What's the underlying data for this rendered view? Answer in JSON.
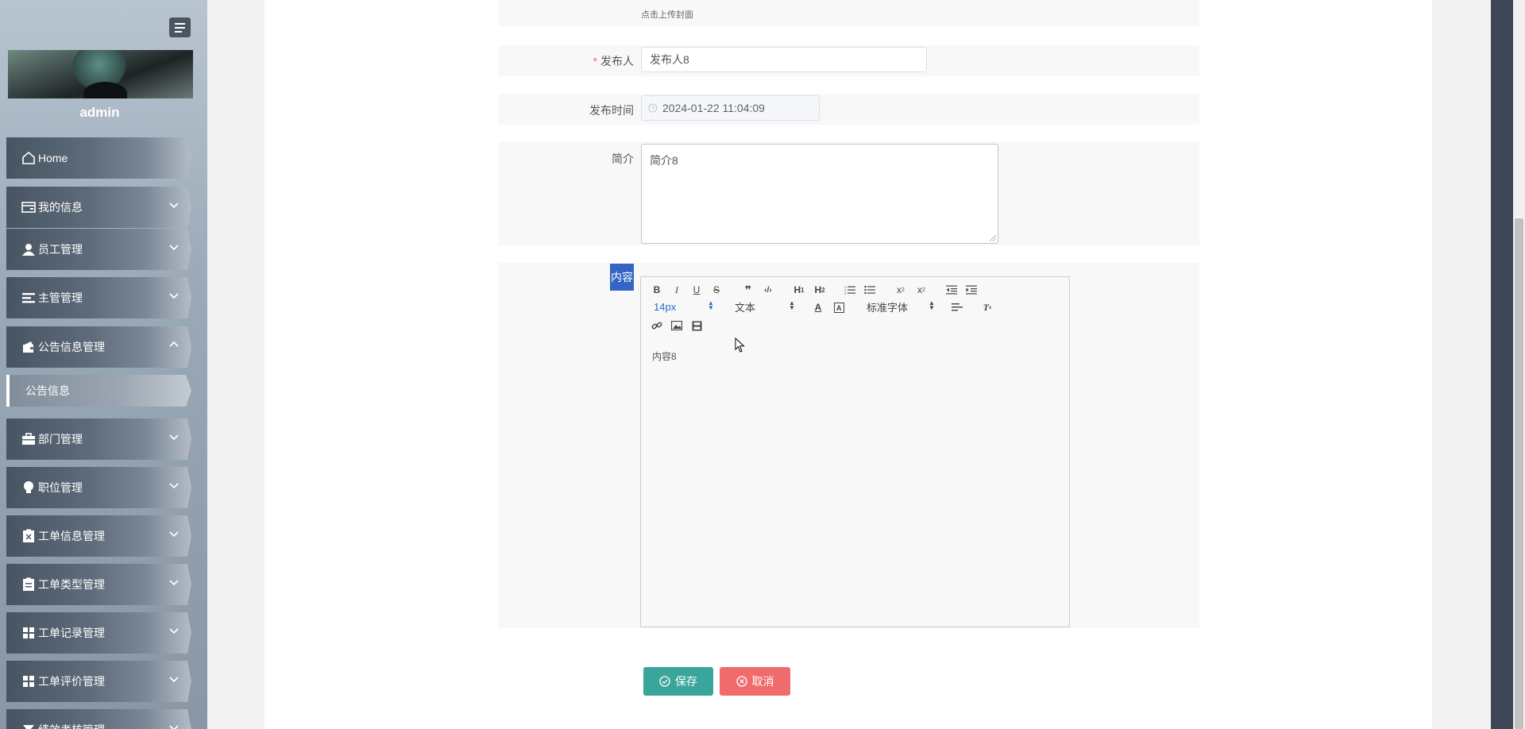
{
  "sidebar": {
    "username": "admin",
    "menu": [
      {
        "label": "Home",
        "icon": "home-icon",
        "has_chevron": false
      },
      {
        "label": "我的信息",
        "icon": "wallet-icon",
        "has_chevron": true
      },
      {
        "label": "员工管理",
        "icon": "user-icon",
        "has_chevron": true
      },
      {
        "label": "主管管理",
        "icon": "list-icon",
        "has_chevron": true
      },
      {
        "label": "公告信息管理",
        "icon": "wallet-icon",
        "has_chevron": true,
        "expanded": true
      },
      {
        "label": "部门管理",
        "icon": "briefcase-icon",
        "has_chevron": true
      },
      {
        "label": "职位管理",
        "icon": "lightbulb-icon",
        "has_chevron": true
      },
      {
        "label": "工单信息管理",
        "icon": "clipboard-x-icon",
        "has_chevron": true
      },
      {
        "label": "工单类型管理",
        "icon": "clipboard-icon",
        "has_chevron": true
      },
      {
        "label": "工单记录管理",
        "icon": "grid-icon",
        "has_chevron": true
      },
      {
        "label": "工单评价管理",
        "icon": "grid-icon",
        "has_chevron": true
      },
      {
        "label": "绩效考核管理",
        "icon": "filter-icon",
        "has_chevron": true
      }
    ],
    "submenu_active": "公告信息"
  },
  "form": {
    "cover_hint": "点击上传封面",
    "publisher_label": "发布人",
    "publisher_value": "发布人8",
    "time_label": "发布时间",
    "time_value": "2024-01-22 11:04:09",
    "summary_label": "简介",
    "summary_value": "简介8",
    "content_label": "内容",
    "content_value": "内容8"
  },
  "editor": {
    "font_size": "14px",
    "heading_select": "文本",
    "font_family_select": "标准字体",
    "buttons": [
      "bold-icon",
      "italic-icon",
      "underline-icon",
      "strike-icon",
      "quote-icon",
      "code-icon",
      "h1-icon",
      "h2-icon",
      "ordered-list-icon",
      "bullet-list-icon",
      "subscript-icon",
      "superscript-icon",
      "outdent-icon",
      "indent-icon",
      "font-color-icon",
      "background-color-icon",
      "align-icon",
      "clear-format-icon",
      "link-icon",
      "image-icon",
      "video-icon"
    ]
  },
  "actions": {
    "save_label": "保存",
    "cancel_label": "取消"
  },
  "colors": {
    "save": "#3aa59a",
    "cancel": "#f06c6c",
    "content_label_bg": "#3465c4",
    "required": "#f56c6c"
  }
}
